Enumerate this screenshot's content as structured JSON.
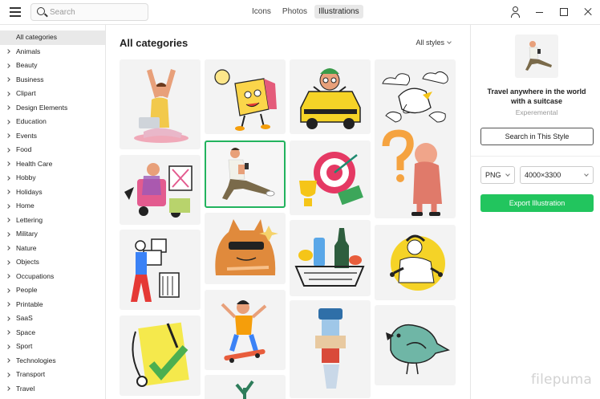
{
  "toolbar": {
    "search_placeholder": "Search",
    "tabs": [
      {
        "label": "Icons",
        "active": false
      },
      {
        "label": "Photos",
        "active": false
      },
      {
        "label": "Illustrations",
        "active": true
      }
    ],
    "icons": [
      "menu-icon",
      "search-icon",
      "user-icon",
      "minimize-icon",
      "maximize-icon",
      "close-icon"
    ]
  },
  "sidebar": {
    "items": [
      {
        "label": "All categories",
        "active": true
      },
      {
        "label": "Animals"
      },
      {
        "label": "Beauty"
      },
      {
        "label": "Business"
      },
      {
        "label": "Clipart"
      },
      {
        "label": "Design Elements"
      },
      {
        "label": "Education"
      },
      {
        "label": "Events"
      },
      {
        "label": "Food"
      },
      {
        "label": "Health Care"
      },
      {
        "label": "Hobby"
      },
      {
        "label": "Holidays"
      },
      {
        "label": "Home"
      },
      {
        "label": "Lettering"
      },
      {
        "label": "Military"
      },
      {
        "label": "Nature"
      },
      {
        "label": "Objects"
      },
      {
        "label": "Occupations"
      },
      {
        "label": "People"
      },
      {
        "label": "Printable"
      },
      {
        "label": "SaaS"
      },
      {
        "label": "Space"
      },
      {
        "label": "Sport"
      },
      {
        "label": "Technologies"
      },
      {
        "label": "Transport"
      },
      {
        "label": "Travel"
      }
    ]
  },
  "main": {
    "title": "All categories",
    "style_filter": "All styles"
  },
  "details": {
    "title": "Travel anywhere in the world with a suitcase",
    "style": "Experemental",
    "search_style_label": "Search in This Style",
    "format": "PNG",
    "size": "4000×3300",
    "export_label": "Export Illustration"
  },
  "colors": {
    "accent": "#22c55e",
    "selected_border": "#22b35e"
  },
  "watermark": "filepuma"
}
